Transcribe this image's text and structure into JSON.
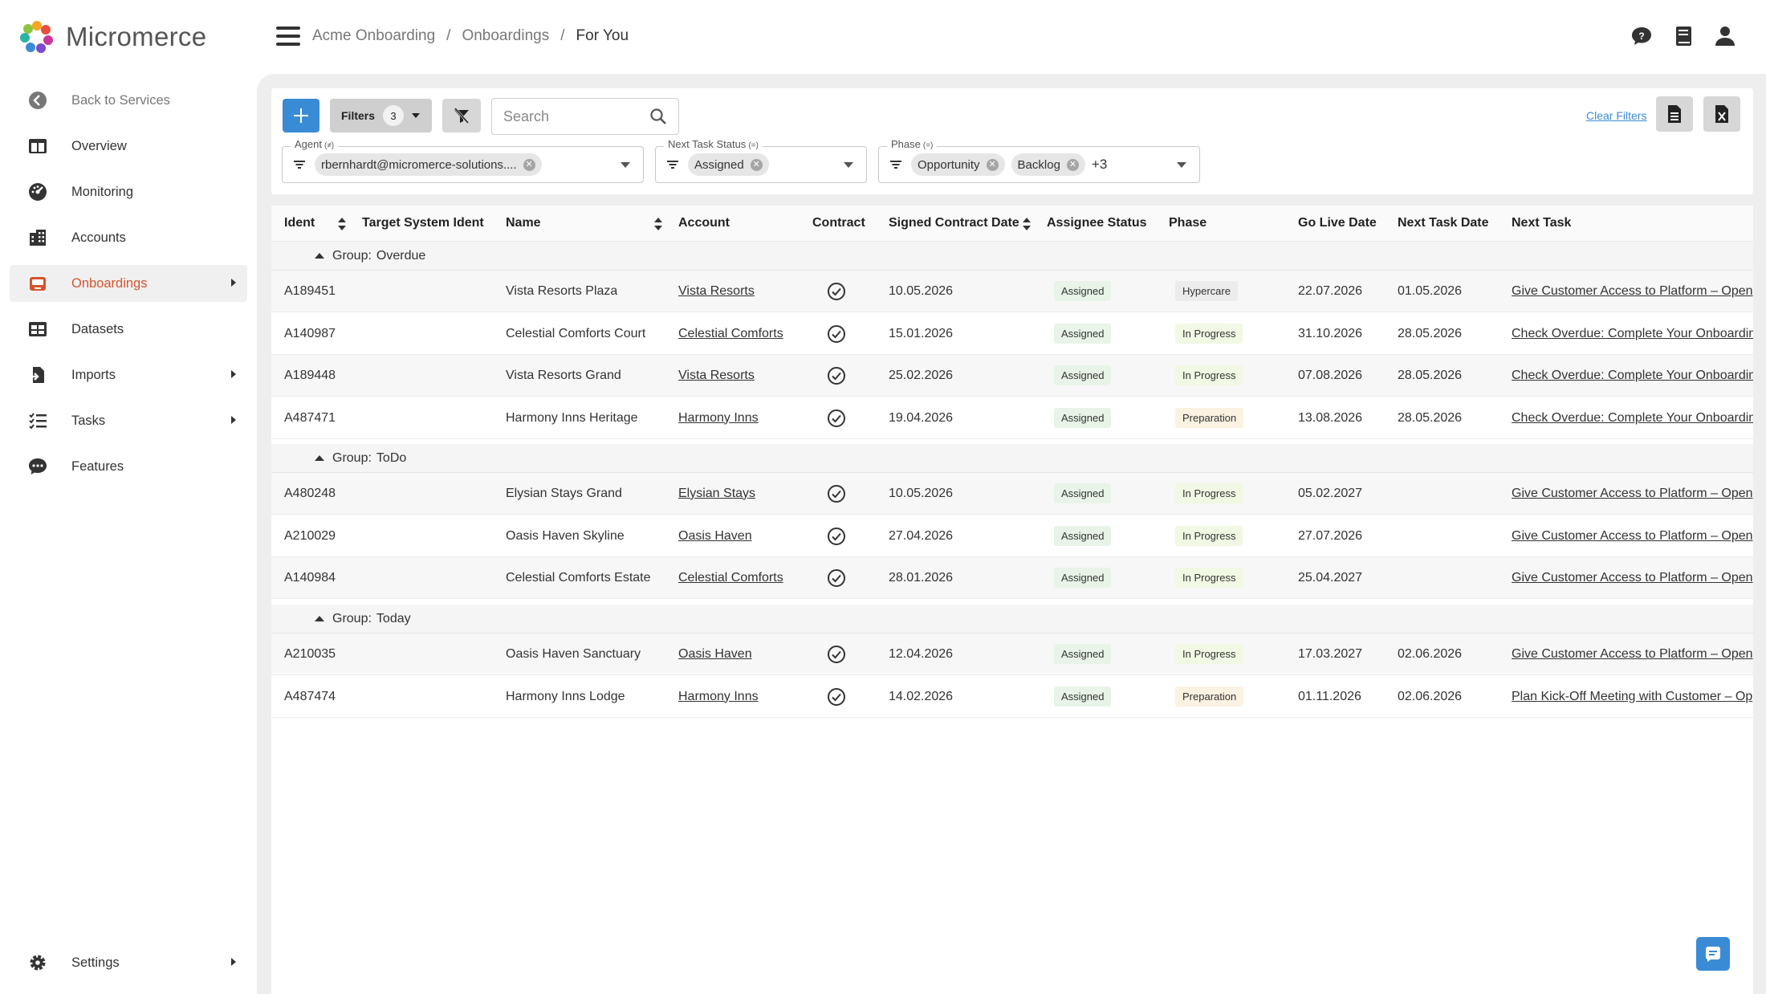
{
  "app": {
    "name": "Micromerce"
  },
  "breadcrumb": {
    "items": [
      "Acme Onboarding",
      "Onboardings"
    ],
    "current": "For You",
    "sep": "/"
  },
  "sidebar": {
    "items": [
      {
        "label": "Back to Services",
        "icon": "back-arrow-icon"
      },
      {
        "label": "Overview",
        "icon": "overview-icon"
      },
      {
        "label": "Monitoring",
        "icon": "monitoring-icon"
      },
      {
        "label": "Accounts",
        "icon": "accounts-icon"
      },
      {
        "label": "Onboardings",
        "icon": "onboardings-icon",
        "active": true
      },
      {
        "label": "Datasets",
        "icon": "datasets-icon"
      },
      {
        "label": "Imports",
        "icon": "imports-icon"
      },
      {
        "label": "Tasks",
        "icon": "tasks-icon"
      },
      {
        "label": "Features",
        "icon": "features-icon"
      },
      {
        "label": "Settings",
        "icon": "settings-icon"
      }
    ]
  },
  "toolbar": {
    "filters_label": "Filters",
    "filters_count": "3",
    "search_placeholder": "Search",
    "clear_filters_label": "Clear Filters"
  },
  "filters": {
    "agent": {
      "label": "Agent",
      "op": "(≠)",
      "chip": "rbernhardt@micromerce-solutions...."
    },
    "next_task_status": {
      "label": "Next Task Status",
      "op": "(=)",
      "chip": "Assigned"
    },
    "phase": {
      "label": "Phase",
      "op": "(=)",
      "chips": [
        "Opportunity",
        "Backlog"
      ],
      "more": "+3"
    }
  },
  "table": {
    "headers": {
      "ident": "Ident",
      "target": "Target System Ident",
      "name": "Name",
      "account": "Account",
      "contract": "Contract",
      "signed": "Signed Contract Date",
      "assignee": "Assignee Status",
      "phase": "Phase",
      "golive": "Go Live Date",
      "nexttaskdate": "Next Task Date",
      "nexttask": "Next Task"
    },
    "group_prefix": "Group:",
    "groups": [
      {
        "name": "Overdue"
      },
      {
        "name": "ToDo"
      },
      {
        "name": "Today"
      }
    ],
    "rows": [
      {
        "ident": "A189451",
        "name": "Vista Resorts Plaza",
        "account": "Vista Resorts",
        "signed": "10.05.2026",
        "assignee": "Assigned",
        "phase": "Hypercare",
        "golive": "22.07.2026",
        "nexttaskdate": "01.05.2026",
        "nexttask": "Give Customer Access to Platform – Open"
      },
      {
        "ident": "A140987",
        "name": "Celestial Comforts Court",
        "account": "Celestial Comforts",
        "signed": "15.01.2026",
        "assignee": "Assigned",
        "phase": "In Progress",
        "golive": "31.10.2026",
        "nexttaskdate": "28.05.2026",
        "nexttask": "Check Overdue: Complete Your Onboardin"
      },
      {
        "ident": "A189448",
        "name": "Vista Resorts Grand",
        "account": "Vista Resorts",
        "signed": "25.02.2026",
        "assignee": "Assigned",
        "phase": "In Progress",
        "golive": "07.08.2026",
        "nexttaskdate": "28.05.2026",
        "nexttask": "Check Overdue: Complete Your Onboardin"
      },
      {
        "ident": "A487471",
        "name": "Harmony Inns Heritage",
        "account": "Harmony Inns",
        "signed": "19.04.2026",
        "assignee": "Assigned",
        "phase": "Preparation",
        "golive": "13.08.2026",
        "nexttaskdate": "28.05.2026",
        "nexttask": "Check Overdue: Complete Your Onboardin"
      },
      {
        "ident": "A480248",
        "name": "Elysian Stays Grand",
        "account": "Elysian Stays",
        "signed": "10.05.2026",
        "assignee": "Assigned",
        "phase": "In Progress",
        "golive": "05.02.2027",
        "nexttaskdate": "",
        "nexttask": "Give Customer Access to Platform – Open"
      },
      {
        "ident": "A210029",
        "name": "Oasis Haven Skyline",
        "account": "Oasis Haven",
        "signed": "27.04.2026",
        "assignee": "Assigned",
        "phase": "In Progress",
        "golive": "27.07.2026",
        "nexttaskdate": "",
        "nexttask": "Give Customer Access to Platform – Open"
      },
      {
        "ident": "A140984",
        "name": "Celestial Comforts Estate",
        "account": "Celestial Comforts",
        "signed": "28.01.2026",
        "assignee": "Assigned",
        "phase": "In Progress",
        "golive": "25.04.2027",
        "nexttaskdate": "",
        "nexttask": "Give Customer Access to Platform – Open"
      },
      {
        "ident": "A210035",
        "name": "Oasis Haven Sanctuary",
        "account": "Oasis Haven",
        "signed": "12.04.2026",
        "assignee": "Assigned",
        "phase": "In Progress",
        "golive": "17.03.2027",
        "nexttaskdate": "02.06.2026",
        "nexttask": "Give Customer Access to Platform – Open"
      },
      {
        "ident": "A487474",
        "name": "Harmony Inns Lodge",
        "account": "Harmony Inns",
        "signed": "14.02.2026",
        "assignee": "Assigned",
        "phase": "Preparation",
        "golive": "01.11.2026",
        "nexttaskdate": "02.06.2026",
        "nexttask": "Plan Kick-Off Meeting with Customer – Op"
      }
    ]
  },
  "colors": {
    "accent": "#3a8bd6",
    "active_nav": "#d6542d"
  }
}
